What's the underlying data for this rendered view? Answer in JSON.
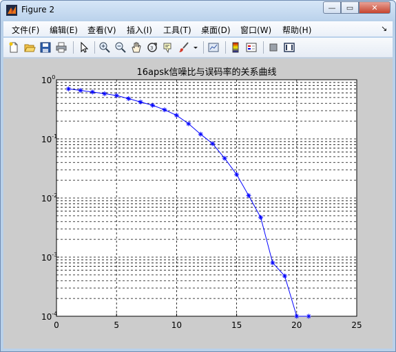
{
  "window": {
    "title": "Figure 2",
    "minimize": "—",
    "restore": "▭",
    "close": "✕"
  },
  "menu": [
    "文件(F)",
    "编辑(E)",
    "查看(V)",
    "插入(I)",
    "工具(T)",
    "桌面(D)",
    "窗口(W)",
    "帮助(H)"
  ],
  "menu_arrow": "↘",
  "toolbar_icons": [
    "new-figure-icon",
    "open-folder-icon",
    "save-icon",
    "print-icon",
    "pointer-icon",
    "zoom-in-icon",
    "zoom-out-icon",
    "pan-hand-icon",
    "rotate-3d-icon",
    "data-cursor-icon",
    "brush-icon",
    "brush-dropdown-icon",
    "link-plot-icon",
    "colorbar-icon",
    "legend-icon",
    "hide-plot-tools-icon",
    "show-plot-tools-icon"
  ],
  "chart_data": {
    "type": "line",
    "title": "16apsk信噪比与误码率的关系曲线",
    "xlabel": "",
    "ylabel": "",
    "xlim": [
      0,
      25
    ],
    "ylim": [
      0.0001,
      1
    ],
    "yscale": "log",
    "grid": true,
    "x_ticks": [
      "0",
      "5",
      "10",
      "15",
      "20",
      "25"
    ],
    "y_ticks": [
      {
        "base": "10",
        "exp": "0"
      },
      {
        "base": "10",
        "exp": "-1"
      },
      {
        "base": "10",
        "exp": "-2"
      },
      {
        "base": "10",
        "exp": "-3"
      },
      {
        "base": "10",
        "exp": "-4"
      }
    ],
    "series": [
      {
        "color": "#0000ff",
        "marker": "*",
        "x": [
          1,
          2,
          3,
          4,
          5,
          6,
          7,
          8,
          9,
          10,
          11,
          12,
          13,
          14,
          15,
          16,
          17,
          18,
          19,
          20,
          21
        ],
        "y": [
          0.7,
          0.66,
          0.62,
          0.58,
          0.54,
          0.48,
          0.42,
          0.37,
          0.31,
          0.25,
          0.18,
          0.12,
          0.083,
          0.047,
          0.025,
          0.011,
          0.0047,
          0.0008,
          0.00048,
          0.0001,
          0.0001
        ]
      }
    ]
  }
}
